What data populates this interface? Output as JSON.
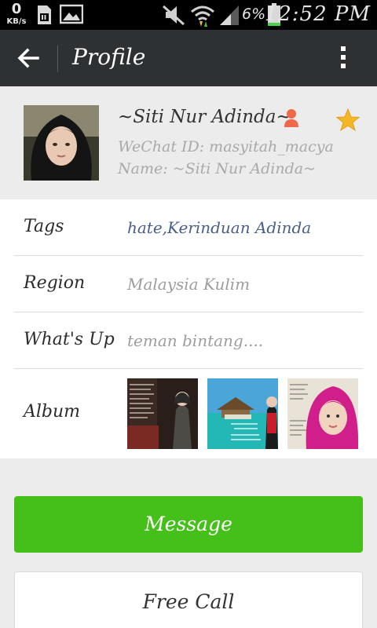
{
  "status_bar": {
    "speed_value": "0",
    "speed_unit": "KB/s",
    "battery_percent": "6%",
    "time": "12:52 PM",
    "icons": [
      "sim-icon",
      "image-icon",
      "mute-icon",
      "wifi-icon",
      "signal-icon",
      "battery-icon"
    ]
  },
  "toolbar": {
    "title": "Profile",
    "back_icon": "arrow-left-icon",
    "menu_icon": "more-vertical-icon"
  },
  "profile": {
    "display_name": "~Siti Nur Adinda~",
    "wechat_id": "WeChat ID: masyitah_macya",
    "name": "Name: ~Siti Nur Adinda~",
    "gender_icon": "female-icon",
    "star_icon": "star-icon",
    "accent_star": "#f5b726",
    "accent_gender": "#f0684a"
  },
  "details": {
    "tags_label": "Tags",
    "tags_value": "hate,Kerinduan Adinda",
    "region_label": "Region",
    "region_value": "Malaysia  Kulim",
    "whatsup_label": "What's Up",
    "whatsup_value": "teman bintang....",
    "album_label": "Album"
  },
  "actions": {
    "message_label": "Message",
    "call_label": "Free Call",
    "message_color": "#45c01a"
  }
}
